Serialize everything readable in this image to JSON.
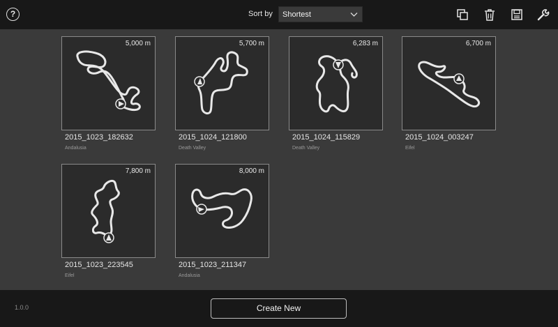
{
  "header": {
    "sort_label": "Sort by",
    "sort_value": "Shortest",
    "icons": [
      "help-icon",
      "duplicate-icon",
      "trash-icon",
      "save-icon",
      "wrench-icon"
    ]
  },
  "tracks": [
    {
      "length": "5,000 m",
      "name": "2015_1023_182632",
      "location": "Andalusia"
    },
    {
      "length": "5,700 m",
      "name": "2015_1024_121800",
      "location": "Death Valley"
    },
    {
      "length": "6,283 m",
      "name": "2015_1024_115829",
      "location": "Death Valley"
    },
    {
      "length": "6,700 m",
      "name": "2015_1024_003247",
      "location": "Eifel"
    },
    {
      "length": "7,800 m",
      "name": "2015_1023_223545",
      "location": "Eifel"
    },
    {
      "length": "8,000 m",
      "name": "2015_1023_211347",
      "location": "Andalusia"
    }
  ],
  "footer": {
    "version": "1.0.0",
    "create_label": "Create New"
  },
  "colors": {
    "background": "#3a3a3a",
    "bar": "#181818",
    "thumb": "#2b2b2b",
    "track": "#e8e8e8"
  }
}
